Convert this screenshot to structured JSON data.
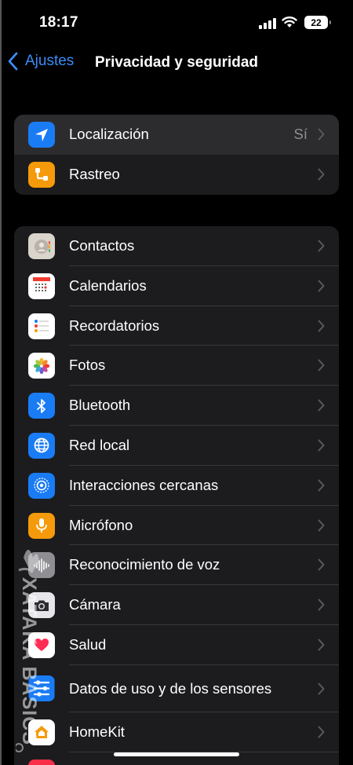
{
  "status_bar": {
    "time": "18:17",
    "battery": "22"
  },
  "nav": {
    "back_label": "Ajustes",
    "title": "Privacidad y seguridad"
  },
  "groups": [
    {
      "items": [
        {
          "label": "Localización",
          "value": "Sí",
          "icon": "location-icon",
          "color": "#1a7cf5"
        },
        {
          "label": "Rastreo",
          "value": "",
          "icon": "tracking-icon",
          "color": "#f59a0a"
        }
      ]
    },
    {
      "items": [
        {
          "label": "Contactos",
          "icon": "contacts-icon",
          "color": "#d9d4cc"
        },
        {
          "label": "Calendarios",
          "icon": "calendar-icon",
          "color": "#ffffff"
        },
        {
          "label": "Recordatorios",
          "icon": "reminders-icon",
          "color": "#ffffff"
        },
        {
          "label": "Fotos",
          "icon": "photos-icon",
          "color": "#ffffff"
        },
        {
          "label": "Bluetooth",
          "icon": "bluetooth-icon",
          "color": "#1a7cf5"
        },
        {
          "label": "Red local",
          "icon": "globe-icon",
          "color": "#1a7cf5"
        },
        {
          "label": "Interacciones cercanas",
          "icon": "nearby-icon",
          "color": "#1a7cf5"
        },
        {
          "label": "Micrófono",
          "icon": "microphone-icon",
          "color": "#f59a0a"
        },
        {
          "label": "Reconocimiento de voz",
          "icon": "waveform-icon",
          "color": "#8e8e93"
        },
        {
          "label": "Cámara",
          "icon": "camera-icon",
          "color": "#8e8e93"
        },
        {
          "label": "Salud",
          "icon": "heart-icon",
          "color": "#ffffff"
        },
        {
          "label": "Datos de uso y de los sensores",
          "icon": "sensor-data-icon",
          "color": "#1a7cf5"
        },
        {
          "label": "HomeKit",
          "icon": "home-icon",
          "color": "#ffffff"
        }
      ]
    }
  ],
  "watermark": "XATAKA BASICS",
  "accent_color": "#3b8df5"
}
